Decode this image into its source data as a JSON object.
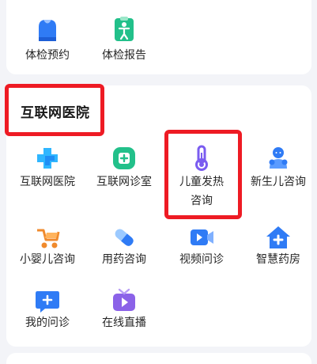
{
  "top_items": [
    {
      "label": "体检预约",
      "icon": "health-checkup-booking-icon"
    },
    {
      "label": "体检报告",
      "icon": "health-report-icon"
    }
  ],
  "section": {
    "title": "互联网医院"
  },
  "items": [
    {
      "label": "互联网医院",
      "icon": "hospital-cross-icon"
    },
    {
      "label": "互联网诊室",
      "icon": "clinic-room-icon"
    },
    {
      "label": "儿童发热咨询",
      "label_line1": "儿童发热",
      "label_line2": "咨询",
      "icon": "thermometer-icon"
    },
    {
      "label": "新生儿咨询",
      "icon": "newborn-icon"
    },
    {
      "label": "小婴儿咨询",
      "icon": "baby-stroller-icon"
    },
    {
      "label": "用药咨询",
      "icon": "pill-icon"
    },
    {
      "label": "视频问诊",
      "icon": "video-camera-icon"
    },
    {
      "label": "智慧药房",
      "icon": "pharmacy-house-icon"
    },
    {
      "label": "我的问诊",
      "icon": "my-consultation-icon"
    },
    {
      "label": "在线直播",
      "icon": "live-tv-icon"
    }
  ],
  "colors": {
    "highlight_border": "#ee1b24",
    "accent_blue": "#2f7bf5",
    "accent_green": "#22c08a",
    "accent_purple": "#7a5cf0",
    "accent_orange": "#f08a2c"
  }
}
